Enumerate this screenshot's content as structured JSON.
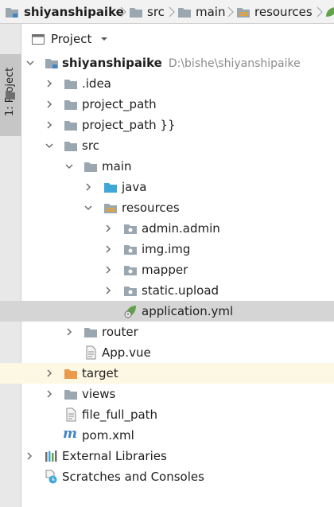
{
  "breadcrumb": {
    "items": [
      {
        "label": "shiyanshipaike"
      },
      {
        "label": "src"
      },
      {
        "label": "main"
      },
      {
        "label": "resources"
      }
    ]
  },
  "tool_window": {
    "stripe_label": "1: Project",
    "header_label": "Project"
  },
  "tree": {
    "root_name": "shiyanshipaike",
    "root_path": "D:\\bishe\\shiyanshipaike",
    "idea": ".idea",
    "project_path": "project_path",
    "project_path_braces": "project_path }}",
    "src": "src",
    "main": "main",
    "java": "java",
    "resources": "resources",
    "admin_admin": "admin.admin",
    "img_img": "img.img",
    "mapper": "mapper",
    "static_upload": "static.upload",
    "application_yml": "application.yml",
    "router": "router",
    "app_vue": "App.vue",
    "target": "target",
    "views": "views",
    "file_full_path": "file_full_path",
    "pom_xml": "pom.xml",
    "external_libraries": "External Libraries",
    "scratches": "Scratches and Consoles"
  },
  "colors": {
    "folder": "#9aa7b0",
    "source_folder": "#40a8d8",
    "excluded_folder": "#e99a4c",
    "excluded_row": "#fdf8e3",
    "selected_row": "#d5d5d5",
    "spring_green": "#62a34a",
    "maven_blue": "#3f84c4"
  }
}
